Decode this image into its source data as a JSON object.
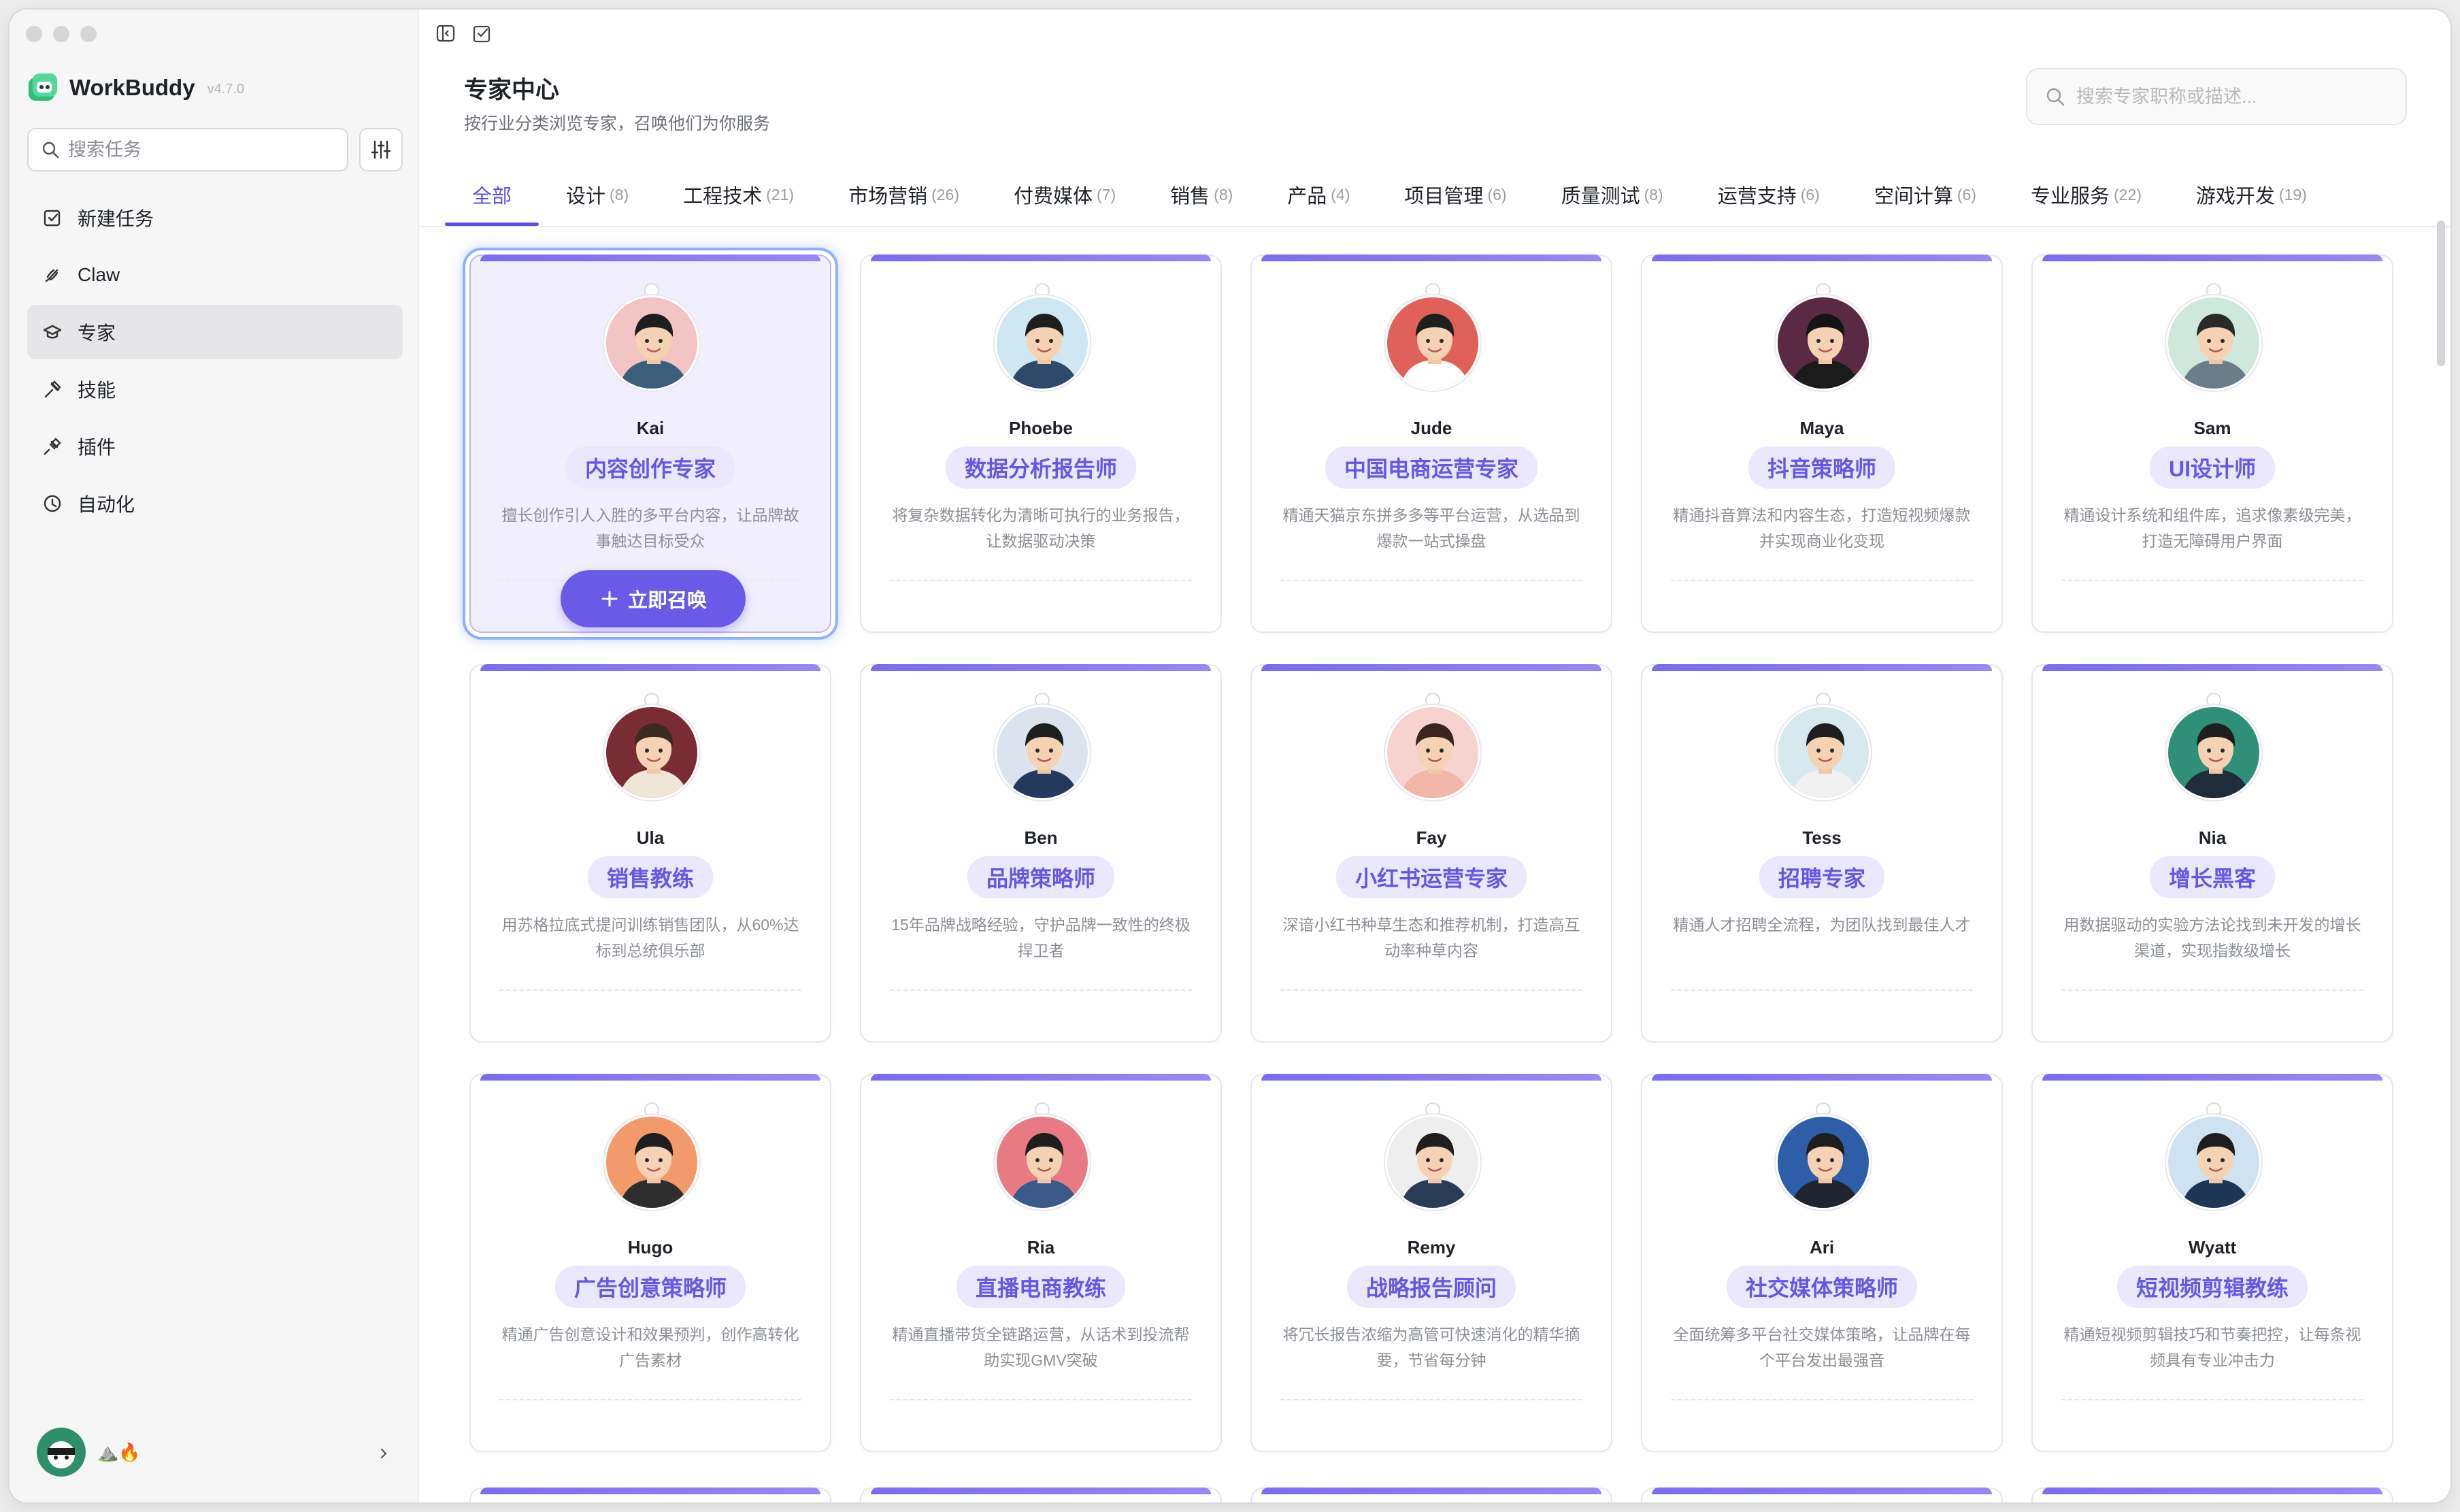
{
  "app": {
    "name": "WorkBuddy",
    "version": "v4.7.0"
  },
  "sidebar": {
    "search_placeholder": "搜索任务",
    "items": [
      {
        "label": "新建任务",
        "icon": "new-task-icon"
      },
      {
        "label": "Claw",
        "icon": "claw-icon"
      },
      {
        "label": "专家",
        "icon": "expert-cap-icon",
        "active": true
      },
      {
        "label": "技能",
        "icon": "skills-icon"
      },
      {
        "label": "插件",
        "icon": "plugin-icon"
      },
      {
        "label": "自动化",
        "icon": "clock-icon"
      }
    ],
    "user_badges": "⛰️🔥"
  },
  "header": {
    "title": "专家中心",
    "subtitle": "按行业分类浏览专家，召唤他们为你服务",
    "search_placeholder": "搜索专家职称或描述..."
  },
  "tabs": [
    {
      "label": "全部",
      "count": "",
      "active": true
    },
    {
      "label": "设计",
      "count": "(8)"
    },
    {
      "label": "工程技术",
      "count": "(21)"
    },
    {
      "label": "市场营销",
      "count": "(26)"
    },
    {
      "label": "付费媒体",
      "count": "(7)"
    },
    {
      "label": "销售",
      "count": "(8)"
    },
    {
      "label": "产品",
      "count": "(4)"
    },
    {
      "label": "项目管理",
      "count": "(6)"
    },
    {
      "label": "质量测试",
      "count": "(8)"
    },
    {
      "label": "运营支持",
      "count": "(6)"
    },
    {
      "label": "空间计算",
      "count": "(6)"
    },
    {
      "label": "专业服务",
      "count": "(22)"
    },
    {
      "label": "游戏开发",
      "count": "(19)"
    }
  ],
  "summon_label": "立即召唤",
  "experts": [
    {
      "name": "Kai",
      "role": "内容创作专家",
      "desc": "擅长创作引人入胜的多平台内容，让品牌故事触达目标受众",
      "bg": "#f3c4c4",
      "shirt": "#3b5f7a",
      "hair": "#1e1e1e",
      "featured": true
    },
    {
      "name": "Phoebe",
      "role": "数据分析报告师",
      "desc": "将复杂数据转化为清晰可执行的业务报告，让数据驱动决策",
      "bg": "#cfe6f3",
      "shirt": "#2e4a6b",
      "hair": "#1e1e1e"
    },
    {
      "name": "Jude",
      "role": "中国电商运营专家",
      "desc": "精通天猫京东拼多多等平台运营，从选品到爆款一站式操盘",
      "bg": "#e0605a",
      "shirt": "#ffffff",
      "hair": "#1e1e1e"
    },
    {
      "name": "Maya",
      "role": "抖音策略师",
      "desc": "精通抖音算法和内容生态，打造短视频爆款并实现商业化变现",
      "bg": "#5a2a44",
      "shirt": "#1b1b1b",
      "hair": "#141414"
    },
    {
      "name": "Sam",
      "role": "UI设计师",
      "desc": "精通设计系统和组件库，追求像素级完美，打造无障碍用户界面",
      "bg": "#cfe8dc",
      "shirt": "#6b7d88",
      "hair": "#2a2a2a"
    },
    {
      "name": "Ula",
      "role": "销售教练",
      "desc": "用苏格拉底式提问训练销售团队，从60%达标到总统俱乐部",
      "bg": "#7a2c34",
      "shirt": "#f0e6d8",
      "hair": "#3a2a20"
    },
    {
      "name": "Ben",
      "role": "品牌策略师",
      "desc": "15年品牌战略经验，守护品牌一致性的终极捍卫者",
      "bg": "#dbe4ee",
      "shirt": "#233a5c",
      "hair": "#1e1e1e"
    },
    {
      "name": "Fay",
      "role": "小红书运营专家",
      "desc": "深谙小红书种草生态和推荐机制，打造高互动率种草内容",
      "bg": "#f7d3cf",
      "shirt": "#f2b7a8",
      "hair": "#3b2420"
    },
    {
      "name": "Tess",
      "role": "招聘专家",
      "desc": "精通人才招聘全流程，为团队找到最佳人才",
      "bg": "#d7e8ef",
      "shirt": "#f1f1f1",
      "hair": "#1e1e1e"
    },
    {
      "name": "Nia",
      "role": "增长黑客",
      "desc": "用数据驱动的实验方法论找到未开发的增长渠道，实现指数级增长",
      "bg": "#2f8f78",
      "shirt": "#1f2d3a",
      "hair": "#1e1e1e"
    },
    {
      "name": "Hugo",
      "role": "广告创意策略师",
      "desc": "精通广告创意设计和效果预判，创作高转化广告素材",
      "bg": "#f29a6b",
      "shirt": "#2d2d2d",
      "hair": "#1e1e1e"
    },
    {
      "name": "Ria",
      "role": "直播电商教练",
      "desc": "精通直播带货全链路运营，从话术到投流帮助实现GMV突破",
      "bg": "#e87a84",
      "shirt": "#3a5a8a",
      "hair": "#1e1e1e"
    },
    {
      "name": "Remy",
      "role": "战略报告顾问",
      "desc": "将冗长报告浓缩为高管可快速消化的精华摘要，节省每分钟",
      "bg": "#eeeeee",
      "shirt": "#2a3b55",
      "hair": "#1e1e1e"
    },
    {
      "name": "Ari",
      "role": "社交媒体策略师",
      "desc": "全面统筹多平台社交媒体策略，让品牌在每个平台发出最强音",
      "bg": "#2f5ea8",
      "shirt": "#1f2430",
      "hair": "#1e1e1e"
    },
    {
      "name": "Wyatt",
      "role": "短视频剪辑教练",
      "desc": "精通短视频剪辑技巧和节奏把控，让每条视频具有专业冲击力",
      "bg": "#cfe2f2",
      "shirt": "#1d3557",
      "hair": "#1e1e1e"
    }
  ],
  "colors": {
    "accent": "#5b50e6",
    "role_pill_bg": "#ebe7fd",
    "role_pill_text": "#6657e6",
    "summon_button": "#6a5ae8",
    "brand_green": "#2bbf7a"
  }
}
